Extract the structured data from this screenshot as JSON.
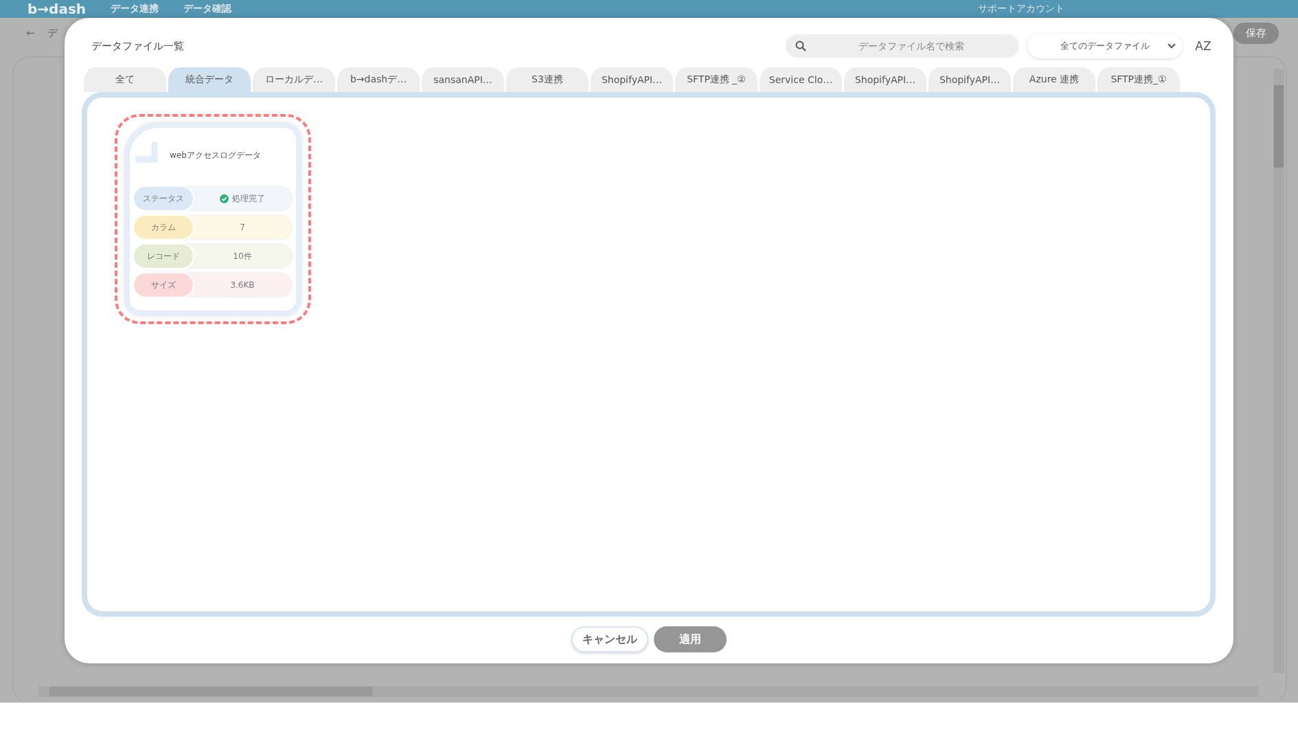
{
  "app": {
    "logo": "b→dash",
    "nav": [
      "データ連携",
      "データ確認"
    ],
    "account": "サポートアカウント",
    "back": "←",
    "crumb": "デ",
    "save": "保存"
  },
  "dialog": {
    "title": "データファイル一覧",
    "search": {
      "placeholder": "データファイル名で検索"
    },
    "filter": {
      "value": "全てのデータファイル"
    },
    "sort": "AZ",
    "tabs": [
      {
        "label": "全て",
        "selected": false
      },
      {
        "label": "統合データ",
        "selected": true
      },
      {
        "label": "ローカルデ…",
        "selected": false
      },
      {
        "label": "b→dashデ…",
        "selected": false
      },
      {
        "label": "sansanAPI…",
        "selected": false
      },
      {
        "label": "S3連携",
        "selected": false
      },
      {
        "label": "ShopifyAPI…",
        "selected": false
      },
      {
        "label": "SFTP連携 _②",
        "selected": false
      },
      {
        "label": "Service Clo…",
        "selected": false
      },
      {
        "label": "ShopifyAPI…",
        "selected": false
      },
      {
        "label": "ShopifyAPI…",
        "selected": false
      },
      {
        "label": "Azure 連携",
        "selected": false
      },
      {
        "label": "SFTP連携_①",
        "selected": false
      }
    ],
    "files": [
      {
        "name": "webアクセスログデータ",
        "selected": true,
        "rows": [
          {
            "kind": "status",
            "label": "ステータス",
            "value": "処理完了",
            "color": "#dbe9f6"
          },
          {
            "kind": "plain",
            "label": "カラム",
            "value": "7",
            "color": "#fbecc0"
          },
          {
            "kind": "plain",
            "label": "レコード",
            "value": "10件",
            "color": "#e6ebd3"
          },
          {
            "kind": "plain",
            "label": "サイズ",
            "value": "3.6KB",
            "color": "#fbd9d9"
          }
        ]
      }
    ],
    "buttons": [
      {
        "label": "キャンセル",
        "disabled": false
      },
      {
        "label": "適用",
        "disabled": true
      }
    ]
  }
}
